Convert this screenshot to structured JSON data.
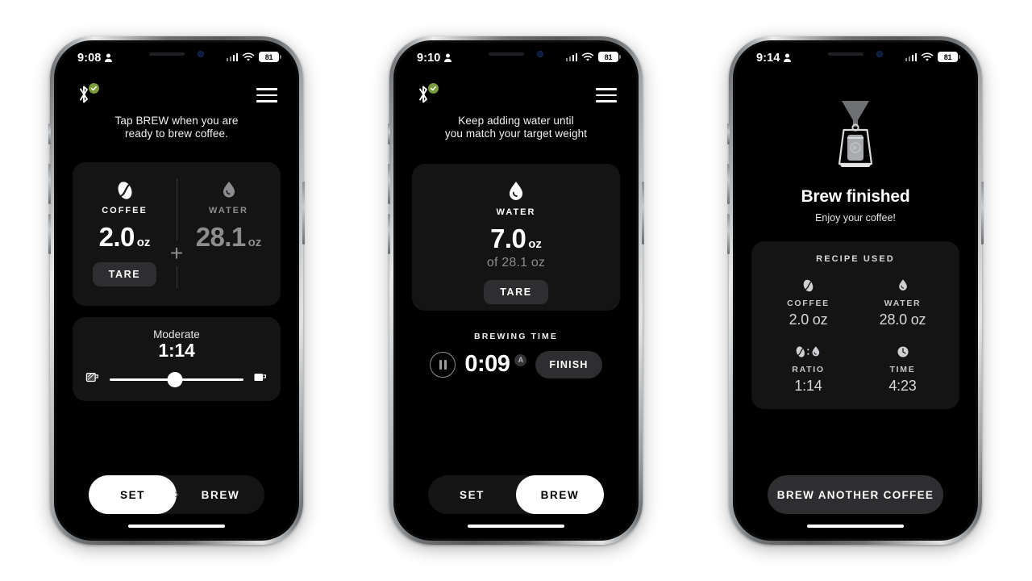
{
  "phones": [
    {
      "status": {
        "time": "9:08",
        "battery": "81"
      },
      "header": {
        "bluetooth_icon": "bluetooth-connected-icon",
        "menu_icon": "hamburger-menu-icon"
      },
      "instruction": "Tap BREW when you are\nready to brew coffee.",
      "coffee": {
        "icon": "coffee-bean-icon",
        "label": "COFFEE",
        "value": "2.0",
        "unit": "oz",
        "tare_label": "TARE"
      },
      "water": {
        "icon": "water-drop-icon",
        "label": "WATER",
        "value": "28.1",
        "unit": "oz"
      },
      "operator": "+",
      "strength": {
        "label": "Moderate",
        "ratio": "1:14",
        "left_icon": "strong-cup-icon",
        "right_icon": "light-cup-icon",
        "position_percent": 49
      },
      "nav": {
        "set_label": "SET",
        "brew_label": "BREW",
        "active": "SET",
        "chevron_icon": "chevron-right-icon"
      }
    },
    {
      "status": {
        "time": "9:10",
        "battery": "81"
      },
      "header": {
        "bluetooth_icon": "bluetooth-connected-icon",
        "menu_icon": "hamburger-menu-icon"
      },
      "instruction": "Keep adding water until\nyou match your target weight",
      "water": {
        "icon": "water-drop-icon",
        "label": "WATER",
        "value": "7.0",
        "unit": "oz",
        "target": "of 28.1 oz",
        "tare_label": "TARE"
      },
      "timer": {
        "section_label": "BREWING TIME",
        "value": "0:09",
        "auto_badge": "A",
        "pause_icon": "pause-icon",
        "finish_label": "FINISH"
      },
      "nav": {
        "set_label": "SET",
        "brew_label": "BREW",
        "active": "BREW"
      }
    },
    {
      "status": {
        "time": "9:14",
        "battery": "81"
      },
      "hero": {
        "icon": "pour-over-brewer-icon",
        "title": "Brew finished",
        "subtitle": "Enjoy your coffee!"
      },
      "recipe": {
        "title": "RECIPE USED",
        "cells": [
          {
            "icon": "coffee-bean-icon",
            "label": "COFFEE",
            "value": "2.0 oz"
          },
          {
            "icon": "water-drop-icon",
            "label": "WATER",
            "value": "28.0 oz"
          },
          {
            "icon": "ratio-bean-drop-icon",
            "label": "RATIO",
            "value": "1:14"
          },
          {
            "icon": "clock-icon",
            "label": "TIME",
            "value": "4:23"
          }
        ]
      },
      "cta": {
        "label": "BREW ANOTHER COFFEE"
      }
    }
  ],
  "colors": {
    "screen_bg": "#000000",
    "card_bg": "#141415",
    "button_bg": "#2e2e30",
    "accent_white": "#ffffff",
    "muted_text": "#8d8d8f",
    "bluetooth_ok": "#7a9a3c"
  }
}
